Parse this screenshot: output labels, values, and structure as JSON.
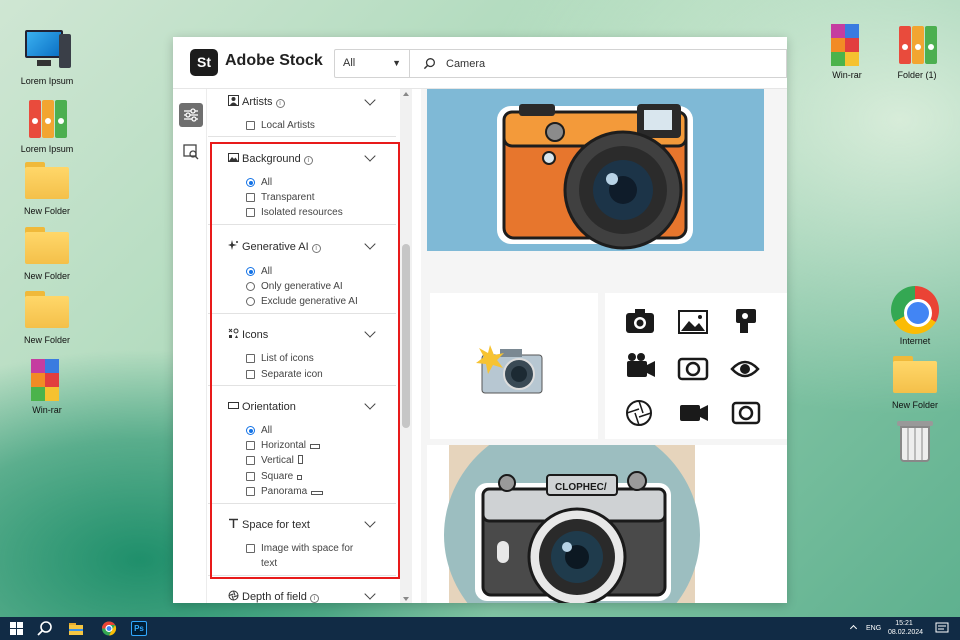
{
  "desktop": {
    "left_icons": [
      {
        "label": "Lorem Ipsum",
        "type": "monitor"
      },
      {
        "label": "Lorem Ipsum",
        "type": "binders"
      },
      {
        "label": "New Folder",
        "type": "folder"
      },
      {
        "label": "New Folder",
        "type": "folder"
      },
      {
        "label": "New Folder",
        "type": "folder"
      },
      {
        "label": "Win-rar",
        "type": "winrar"
      }
    ],
    "right_icons": [
      {
        "label": "Win-rar",
        "type": "winrar"
      },
      {
        "label": "Folder (1)",
        "type": "binders"
      },
      {
        "label": "Internet",
        "type": "chrome"
      },
      {
        "label": "New Folder",
        "type": "folder"
      },
      {
        "label": "",
        "type": "trash"
      }
    ]
  },
  "app": {
    "logo_mark": "St",
    "name": "Adobe Stock",
    "filter_select": {
      "value": "All"
    },
    "search": {
      "value": "Camera",
      "icon": "search-icon"
    }
  },
  "filters": {
    "sections": [
      {
        "title": "Artists",
        "icon": "artist-icon",
        "info": true,
        "options": [
          {
            "label": "Local Artists",
            "kind": "checkbox",
            "checked": false
          }
        ]
      },
      {
        "title": "Background",
        "icon": "image-icon",
        "info": true,
        "options": [
          {
            "label": "All",
            "kind": "radio",
            "checked": true
          },
          {
            "label": "Transparent",
            "kind": "checkbox",
            "checked": false
          },
          {
            "label": "Isolated resources",
            "kind": "checkbox",
            "checked": false
          }
        ]
      },
      {
        "title": "Generative AI",
        "icon": "sparkle-icon",
        "info": true,
        "options": [
          {
            "label": "All",
            "kind": "radio",
            "checked": true
          },
          {
            "label": "Only generative AI",
            "kind": "radio",
            "checked": false
          },
          {
            "label": "Exclude generative AI",
            "kind": "radio",
            "checked": false
          }
        ]
      },
      {
        "title": "Icons",
        "icon": "icons-icon",
        "info": false,
        "options": [
          {
            "label": "List of icons",
            "kind": "checkbox",
            "checked": false
          },
          {
            "label": "Separate icon",
            "kind": "checkbox",
            "checked": false
          }
        ]
      },
      {
        "title": "Orientation",
        "icon": "orientation-icon",
        "info": false,
        "options": [
          {
            "label": "All",
            "kind": "radio",
            "checked": true
          },
          {
            "label": "Horizontal",
            "kind": "checkbox",
            "checked": false
          },
          {
            "label": "Vertical",
            "kind": "checkbox",
            "checked": false
          },
          {
            "label": "Square",
            "kind": "checkbox",
            "checked": false
          },
          {
            "label": "Panorama",
            "kind": "checkbox",
            "checked": false
          }
        ]
      },
      {
        "title": "Space for text",
        "icon": "text-icon",
        "info": false,
        "options": [
          {
            "label": "Image with space for",
            "kind": "checkbox",
            "checked": false
          }
        ],
        "extra_line": "text"
      },
      {
        "title": "Depth of field",
        "icon": "aperture-icon",
        "info": true,
        "options": []
      }
    ]
  },
  "results": {
    "items": [
      {
        "name": "orange-camera-sticker"
      },
      {
        "name": "camera-flash-icon"
      },
      {
        "name": "camera-icon-set"
      },
      {
        "name": "retro-camera-sticker",
        "brand": "CLOPHEC/"
      }
    ]
  },
  "taskbar": {
    "lang": "ENG",
    "time": "15:21",
    "date": "08.02.2024",
    "apps": [
      "windows-start-icon",
      "search-icon",
      "file-explorer-icon",
      "chrome-icon",
      "photoshop-icon"
    ],
    "ps_label": "Ps"
  },
  "colors": {
    "accent": "#1473e6",
    "highlight": "#e81a1a",
    "taskbar": "#112b45"
  }
}
